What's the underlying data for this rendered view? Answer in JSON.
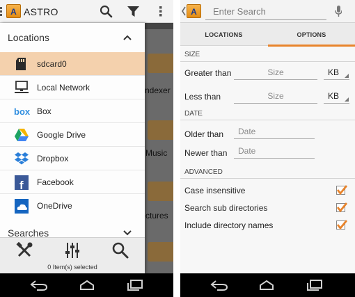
{
  "left_screen": {
    "app_title": "ASTRO",
    "app_icon_letter": "A",
    "background_labels": [
      "ndexer",
      "Music",
      "ctures"
    ],
    "drawer": {
      "locations_header": "Locations",
      "locations": [
        {
          "label": "sdcard0",
          "icon": "sd-card-icon",
          "selected": true
        },
        {
          "label": "Local Network",
          "icon": "network-computer-icon",
          "selected": false
        },
        {
          "label": "Box",
          "icon": "box-icon",
          "selected": false
        },
        {
          "label": "Google Drive",
          "icon": "google-drive-icon",
          "selected": false
        },
        {
          "label": "Dropbox",
          "icon": "dropbox-icon",
          "selected": false
        },
        {
          "label": "Facebook",
          "icon": "facebook-icon",
          "selected": false
        },
        {
          "label": "OneDrive",
          "icon": "onedrive-icon",
          "selected": false
        }
      ],
      "searches_header": "Searches",
      "tools": [
        "tools-icon",
        "equalizer-icon",
        "search-icon"
      ],
      "status": "0 Item(s) selected"
    }
  },
  "right_screen": {
    "app_icon_letter": "A",
    "search_placeholder": "Enter Search",
    "tabs": [
      {
        "label": "LOCATIONS",
        "active": false
      },
      {
        "label": "OPTIONS",
        "active": true
      }
    ],
    "size_section": "SIZE",
    "greater_than_label": "Greater than",
    "less_than_label": "Less than",
    "size_placeholder": "Size",
    "unit": "KB",
    "date_section": "DATE",
    "older_than_label": "Older than",
    "newer_than_label": "Newer than",
    "date_placeholder": "Date",
    "advanced_section": "ADVANCED",
    "options": [
      {
        "label": "Case insensitive",
        "checked": true
      },
      {
        "label": "Search sub directories",
        "checked": true
      },
      {
        "label": "Include directory names",
        "checked": true
      }
    ]
  },
  "colors": {
    "accent": "#e8842c",
    "selected_row": "#f4d1ad",
    "box_blue": "#2f8ee0",
    "facebook_blue": "#3b5998",
    "onedrive_blue": "#1565c0",
    "dropbox_blue": "#2a7fd9"
  }
}
